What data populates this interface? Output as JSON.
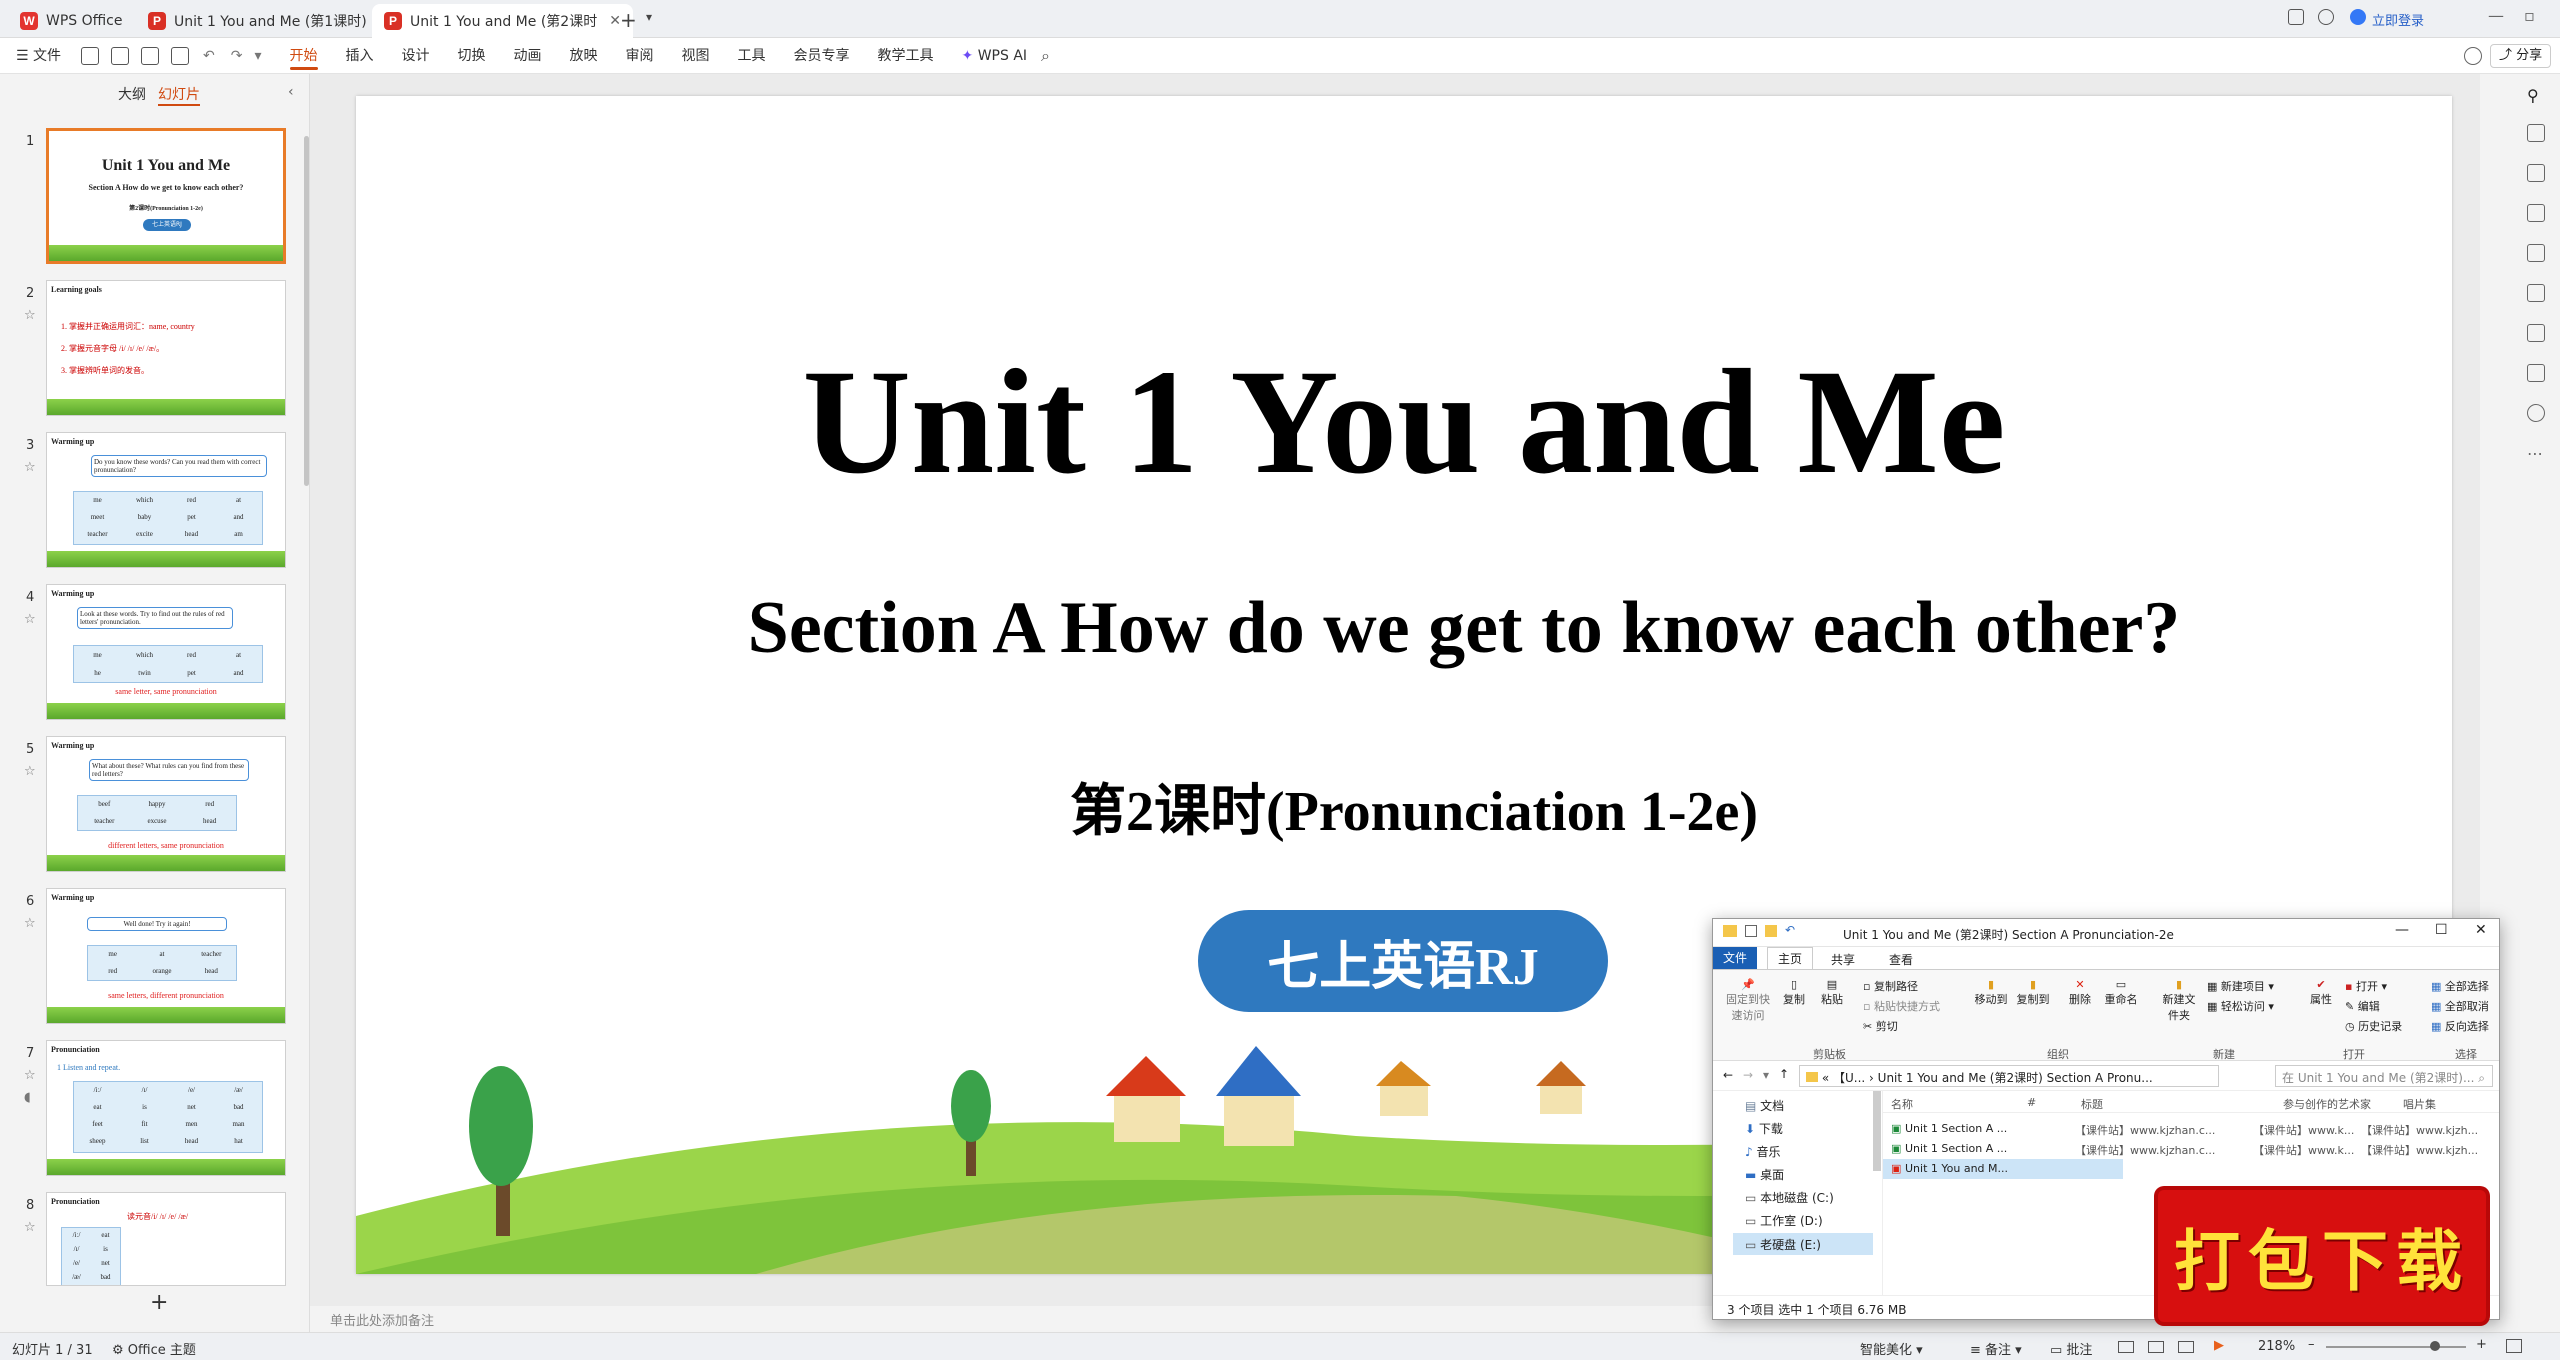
{
  "titlebar": {
    "app_tab": "WPS Office",
    "tab1": "Unit 1 You and Me (第1课时) Secti",
    "tab2": "Unit 1 You and Me (第2课时",
    "login": "立即登录"
  },
  "menubar": {
    "file": "文件",
    "items": [
      "开始",
      "插入",
      "设计",
      "切换",
      "动画",
      "放映",
      "审阅",
      "视图",
      "工具",
      "会员专享",
      "教学工具"
    ],
    "wps_ai": "WPS AI",
    "share": "分享"
  },
  "left_panel": {
    "tab_outline": "大纲",
    "tab_slides": "幻灯片",
    "thumbnails": [
      {
        "num": "1",
        "title": "Unit 1 You and Me",
        "sub": "Section A How do we get to know each other?",
        "lesson": "第2课时(Pronunciation 1-2e)",
        "badge": "七上英语RJ"
      },
      {
        "num": "2",
        "title": "Learning goals",
        "lines": [
          "1. 掌握并正确运用词汇：name, country",
          "2. 掌握元音字母 /i/ /ɪ/ /e/ /æ/。",
          "3. 掌握辨听单词的发音。"
        ]
      },
      {
        "num": "3",
        "title": "Warming up",
        "bubble": "Do you know these words? Can you read them with correct pronunciation?",
        "rows": [
          [
            "me",
            "which",
            "red",
            "at"
          ],
          [
            "meet",
            "baby",
            "pet",
            "and"
          ],
          [
            "teacher",
            "excite",
            "head",
            "am"
          ]
        ]
      },
      {
        "num": "4",
        "title": "Warming up",
        "bubble": "Look at these words. Try to find out the rules of red letters' pronunciation.",
        "rows": [
          [
            "me",
            "which",
            "red",
            "at"
          ],
          [
            "he",
            "twin",
            "pet",
            "and"
          ]
        ],
        "caption": "same letter, same pronunciation"
      },
      {
        "num": "5",
        "title": "Warming up",
        "bubble": "What about these? What rules can you find from these red letters?",
        "rows": [
          [
            "beef",
            "happy",
            "red"
          ],
          [
            "teacher",
            "excuse",
            "head"
          ]
        ],
        "caption": "different letters, same pronunciation"
      },
      {
        "num": "6",
        "title": "Warming up",
        "bubble": "Well done! Try it again!",
        "rows": [
          [
            "me",
            "at",
            "teacher"
          ],
          [
            "red",
            "orange",
            "head"
          ]
        ],
        "caption": "same letters, different pronunciation"
      },
      {
        "num": "7",
        "title": "Pronunciation",
        "sub": "1 Listen and repeat.",
        "rows": [
          [
            "/iː/",
            "/ɪ/",
            "/e/",
            "/æ/"
          ],
          [
            "eat",
            "is",
            "net",
            "bad"
          ],
          [
            "feet",
            "fit",
            "men",
            "man"
          ],
          [
            "sheep",
            "list",
            "head",
            "hat"
          ]
        ]
      },
      {
        "num": "8",
        "title": "Pronunciation",
        "sub": "读元音/i/ /ɪ/ /e/ /æ/",
        "rows": [
          [
            "/iː/",
            "eat"
          ],
          [
            "/ɪ/",
            "is"
          ],
          [
            "/e/",
            "net"
          ],
          [
            "/æ/",
            "bad"
          ]
        ]
      }
    ]
  },
  "slide": {
    "title": "Unit 1 You and Me",
    "subtitle": "Section A How do we get to know each other?",
    "lesson": "第2课时(Pronunciation 1-2e)",
    "badge": "七上英语RJ"
  },
  "notes_placeholder": "单击此处添加备注",
  "statusbar": {
    "slide_count": "幻灯片 1 / 31",
    "theme": "Office 主题",
    "beautify": "智能美化",
    "notes": "备注",
    "comments": "批注",
    "zoom": "218%"
  },
  "explorer": {
    "title": "Unit 1 You and Me (第2课时) Section A Pronunciation-2e",
    "ribbon_tabs": [
      "文件",
      "主页",
      "共享",
      "查看"
    ],
    "groups": {
      "clipboard": "剪贴板",
      "organize": "组织",
      "new": "新建",
      "open": "打开",
      "select": "选择"
    },
    "buttons": {
      "pin": "固定到快速访问",
      "copy": "复制",
      "paste": "粘贴",
      "copy_path": "复制路径",
      "paste_shortcut": "粘贴快捷方式",
      "cut": "剪切",
      "move_to": "移动到",
      "copy_to": "复制到",
      "delete": "删除",
      "rename": "重命名",
      "new_folder": "新建文件夹",
      "new_item": "新建项目",
      "easy_access": "轻松访问",
      "properties": "属性",
      "open": "打开",
      "edit": "编辑",
      "history": "历史记录",
      "select_all": "全部选择",
      "select_none": "全部取消",
      "invert": "反向选择"
    },
    "address": "Unit 1 You and Me (第2课时) Section A Pronu...",
    "address_prefix": "« 【U...",
    "search": "在 Unit 1 You and Me (第2课时)...",
    "nav": [
      "文档",
      "下载",
      "音乐",
      "桌面",
      "本地磁盘 (C:)",
      "工作室 (D:)",
      "老硬盘 (E:)"
    ],
    "columns": [
      "名称",
      "#",
      "标题",
      "参与创作的艺术家",
      "唱片集"
    ],
    "files": [
      {
        "name": "Unit 1 Section A ...",
        "title": "【课件站】www.kjzhan.c...",
        "artist": "【课件站】www.k...",
        "album": "【课件站】www.kjzh..."
      },
      {
        "name": "Unit 1 Section A ...",
        "title": "【课件站】www.kjzhan.c...",
        "artist": "【课件站】www.k...",
        "album": "【课件站】www.kjzh..."
      },
      {
        "name": "Unit 1 You and M...",
        "title": "",
        "artist": "",
        "album": ""
      }
    ],
    "status": "3 个项目    选中 1 个项目  6.76 MB"
  },
  "promo": "打包下载"
}
